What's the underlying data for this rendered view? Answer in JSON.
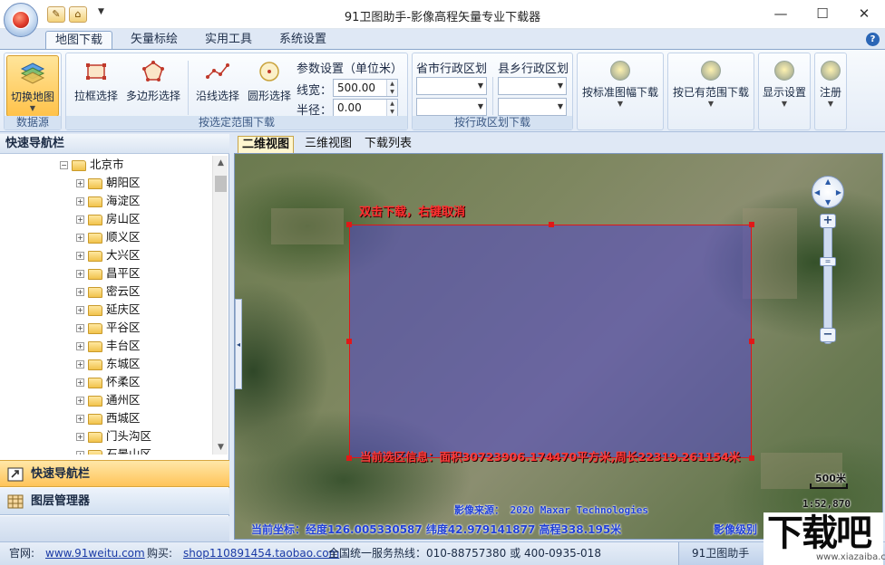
{
  "window": {
    "title": "91卫图助手-影像高程矢量专业下载器",
    "min_glyph": "—",
    "max_glyph": "☐",
    "close_glyph": "✕"
  },
  "ribbon": {
    "tabs": [
      "地图下载",
      "矢量标绘",
      "实用工具",
      "系统设置"
    ],
    "active_tab": "地图下载",
    "groups": {
      "datasource": {
        "label": "数据源",
        "switch_map": "切换地图"
      },
      "range": {
        "label": "按选定范围下载",
        "rect_select": "拉框选择",
        "polygon_select": "多边形选择",
        "line_select": "沿线选择",
        "circle_select": "圆形选择",
        "param_title": "参数设置（单位米）",
        "line_width_label": "线宽：",
        "line_width_value": "500.00",
        "radius_label": "半径：",
        "radius_value": "0.00"
      },
      "admin": {
        "label": "按行政区划下载",
        "province_city": "省市行政区划",
        "county_town": "县乡行政区划"
      },
      "other": {
        "by_sheet": "按标准图幅下载",
        "by_existing": "按已有范围下载",
        "display_settings": "显示设置",
        "register": "注册"
      }
    }
  },
  "left_panel": {
    "header": "快速导航栏",
    "root": "北京市",
    "districts": [
      "朝阳区",
      "海淀区",
      "房山区",
      "顺义区",
      "大兴区",
      "昌平区",
      "密云区",
      "延庆区",
      "平谷区",
      "丰台区",
      "东城区",
      "怀柔区",
      "通州区",
      "西城区",
      "门头沟区",
      "石景山区"
    ],
    "nav_quick": "快速导航栏",
    "nav_layers": "图层管理器"
  },
  "map": {
    "tabs": [
      "二维视图",
      "三维视图",
      "下载列表"
    ],
    "active_tab": "二维视图",
    "hint": "双击下载，右键取消",
    "selection_info": "当前选区信息：面积30723906.174470平方米,周长22319.261154米",
    "source": "影像来源： 2020 Maxar Technologies",
    "coords": "当前坐标：经度126.005330587 纬度42.979141877 高程338.195米",
    "level": "影像级别",
    "scale_text": "500米",
    "scale_ratio": "1:52,870",
    "selection_color": "#5046c8",
    "selection_border": "#e01818"
  },
  "status": {
    "site_label": "官网:",
    "site_url": "www.91weitu.com",
    "buy_label": "购买:",
    "buy_url": "shop110891454.taobao.com",
    "hotline": "全国统一服务热线：010-88757380 或 400-0935-018",
    "app_name": "91卫图助手"
  },
  "watermark": {
    "big": "下载吧",
    "small": "www.xiazaiba.com"
  }
}
